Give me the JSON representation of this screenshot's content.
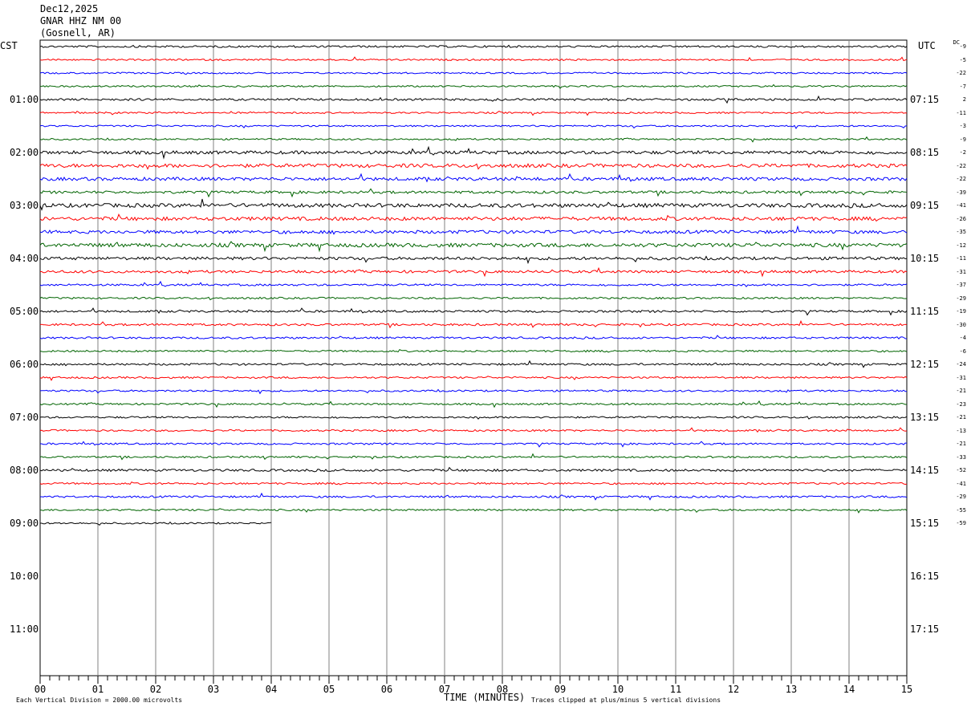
{
  "header": {
    "date": "Dec12,2025",
    "station": "GNAR HHZ NM 00",
    "location": "(Gosnell, AR)"
  },
  "left_timezone": "CST",
  "right_timezone": "UTC",
  "dc_label": "DC",
  "x_axis_label": "TIME (MINUTES)",
  "footer": {
    "scale_note": "Each Vertical Division = 2000.00 microvolts",
    "clip_note": "Traces clipped at plus/minus 5 vertical divisions"
  },
  "colors": {
    "trace_cycle": [
      "#000000",
      "#ff0000",
      "#0000ff",
      "#006400"
    ],
    "grid": "#808080",
    "frame": "#000000"
  },
  "chart_data": {
    "type": "line",
    "title": "GNAR HHZ NM 00",
    "xlabel": "TIME (MINUTES)",
    "ylabel": "",
    "x_range": [
      0,
      15
    ],
    "x_ticks": [
      "00",
      "01",
      "02",
      "03",
      "04",
      "05",
      "06",
      "07",
      "08",
      "09",
      "10",
      "11",
      "12",
      "13",
      "14",
      "15"
    ],
    "hour_rows": [
      {
        "cst": "01:00",
        "utc": "07:15"
      },
      {
        "cst": "02:00",
        "utc": "08:15"
      },
      {
        "cst": "03:00",
        "utc": "09:15"
      },
      {
        "cst": "04:00",
        "utc": "10:15"
      },
      {
        "cst": "05:00",
        "utc": "11:15"
      },
      {
        "cst": "06:00",
        "utc": "12:15"
      },
      {
        "cst": "07:00",
        "utc": "13:15"
      },
      {
        "cst": "08:00",
        "utc": "14:15"
      },
      {
        "cst": "09:00",
        "utc": "15:15"
      },
      {
        "cst": "10:00",
        "utc": "16:15"
      },
      {
        "cst": "11:00",
        "utc": "17:15"
      }
    ],
    "trace_dc_offsets": [
      -9,
      -5,
      -22,
      -7,
      2,
      -11,
      -3,
      -9,
      -2,
      -22,
      -22,
      -39,
      -41,
      -26,
      -35,
      -12,
      -11,
      -31,
      -37,
      -29,
      -19,
      -30,
      -4,
      -6,
      -24,
      -31,
      -21,
      -23,
      -21,
      -13,
      -21,
      -33,
      -52,
      -41,
      -29,
      -55,
      -59
    ],
    "trace_amplitude": [
      1.2,
      1.0,
      1.0,
      1.0,
      1.3,
      1.0,
      1.0,
      1.0,
      2.0,
      2.2,
      2.0,
      1.6,
      2.4,
      2.2,
      2.0,
      2.3,
      1.8,
      1.6,
      1.2,
      1.1,
      1.3,
      1.3,
      1.2,
      1.1,
      1.2,
      1.1,
      1.1,
      1.1,
      1.1,
      1.1,
      1.1,
      1.1,
      1.4,
      1.1,
      1.2,
      1.1,
      1.0
    ],
    "last_trace_end_minute": 4
  }
}
